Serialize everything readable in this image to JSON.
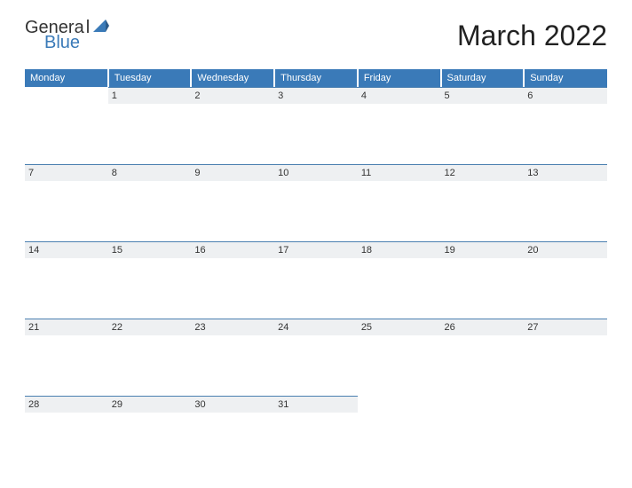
{
  "logo": {
    "general": "Genera",
    "l": "l",
    "blue": "Blue"
  },
  "title": "March 2022",
  "days": [
    "Monday",
    "Tuesday",
    "Wednesday",
    "Thursday",
    "Friday",
    "Saturday",
    "Sunday"
  ],
  "weeks": [
    [
      "",
      "1",
      "2",
      "3",
      "4",
      "5",
      "6"
    ],
    [
      "7",
      "8",
      "9",
      "10",
      "11",
      "12",
      "13"
    ],
    [
      "14",
      "15",
      "16",
      "17",
      "18",
      "19",
      "20"
    ],
    [
      "21",
      "22",
      "23",
      "24",
      "25",
      "26",
      "27"
    ],
    [
      "28",
      "29",
      "30",
      "31",
      "",
      "",
      ""
    ]
  ]
}
